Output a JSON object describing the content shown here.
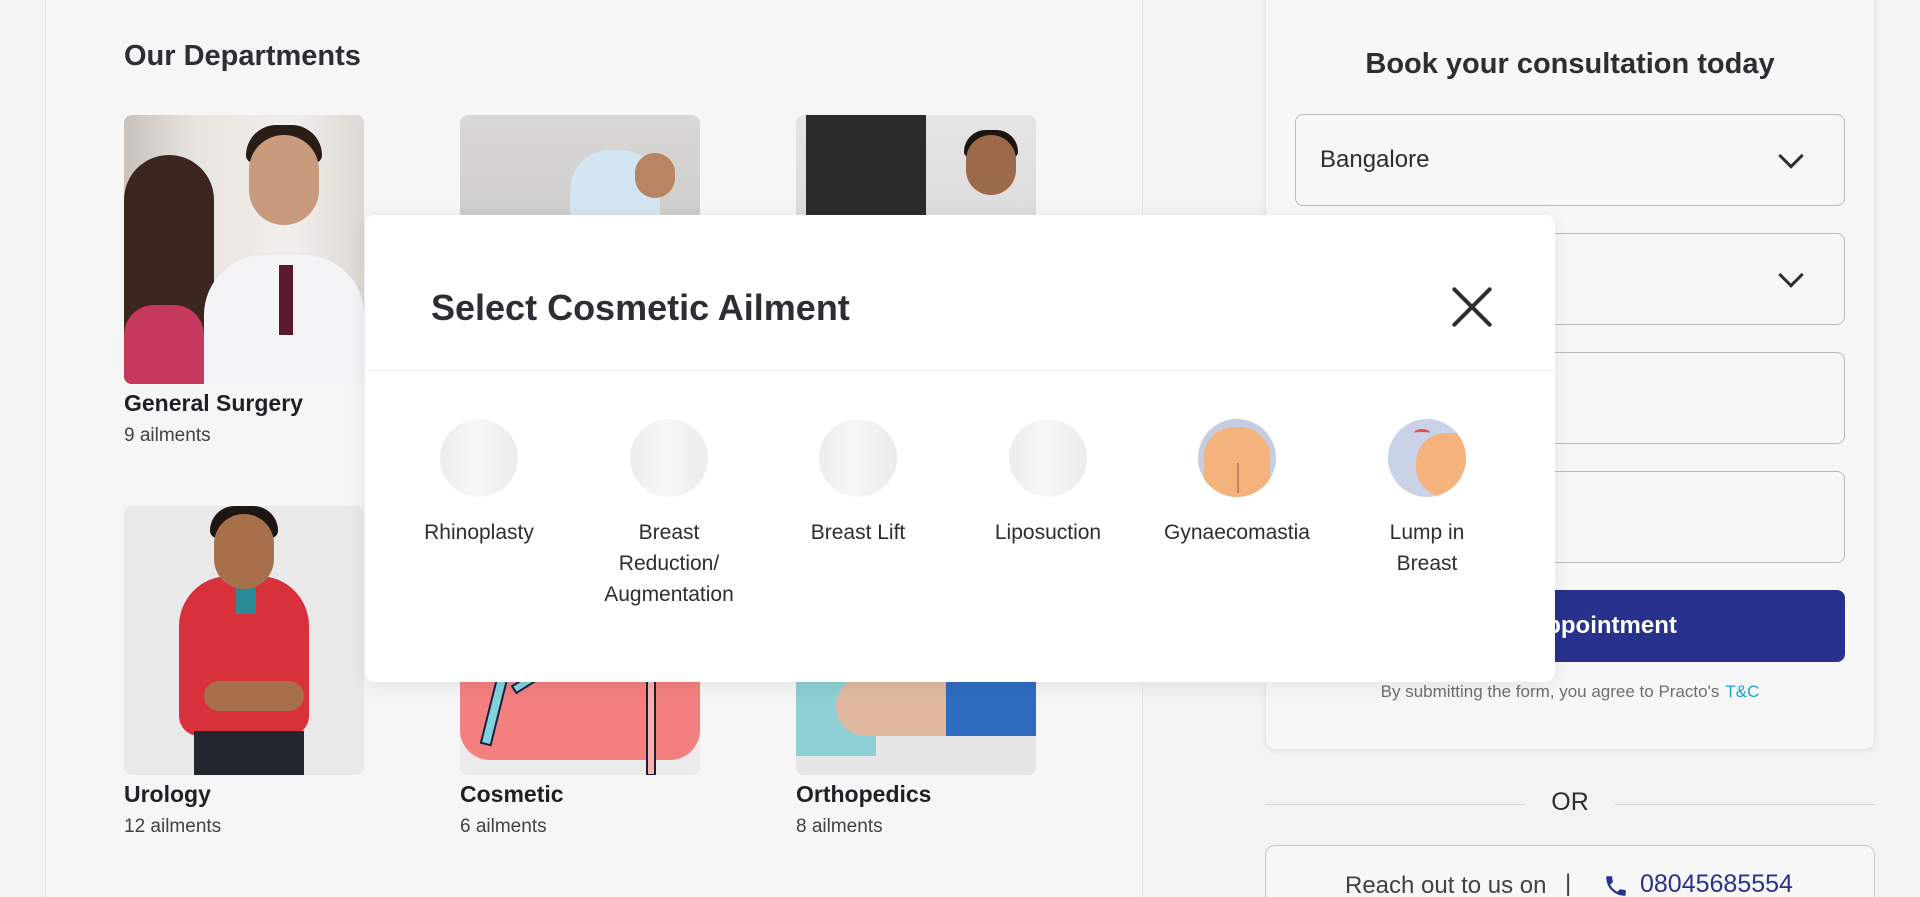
{
  "departments": {
    "title": "Our Departments",
    "items": [
      {
        "name": "General Surgery",
        "count": "9 ailments"
      },
      {
        "name": "",
        "count": ""
      },
      {
        "name": "",
        "count": ""
      },
      {
        "name": "Urology",
        "count": "12 ailments"
      },
      {
        "name": "Cosmetic",
        "count": "6 ailments"
      },
      {
        "name": "Orthopedics",
        "count": "8 ailments"
      }
    ]
  },
  "booking": {
    "title": "Book your consultation today",
    "city_value": "Bangalore",
    "submit_label": "Book Appointment",
    "tnc_text": "By submitting the form, you agree to Practo's",
    "tnc_link": "T&C",
    "or_text": "OR",
    "reach_text": "Reach out to us on",
    "separator": "|",
    "phone": "08045685554",
    "icon_phone": "phone-icon",
    "accent_color": "#28328c",
    "link_color": "#1aa1d6"
  },
  "modal": {
    "title": "Select Cosmetic Ailment",
    "close_icon": "close-icon",
    "ailments": [
      {
        "label": "Rhinoplasty"
      },
      {
        "label": "Breast Reduction/ Augmentation"
      },
      {
        "label": "Breast Lift"
      },
      {
        "label": "Liposuction"
      },
      {
        "label": "Gynaecomastia"
      },
      {
        "label": "Lump in Breast"
      }
    ]
  }
}
